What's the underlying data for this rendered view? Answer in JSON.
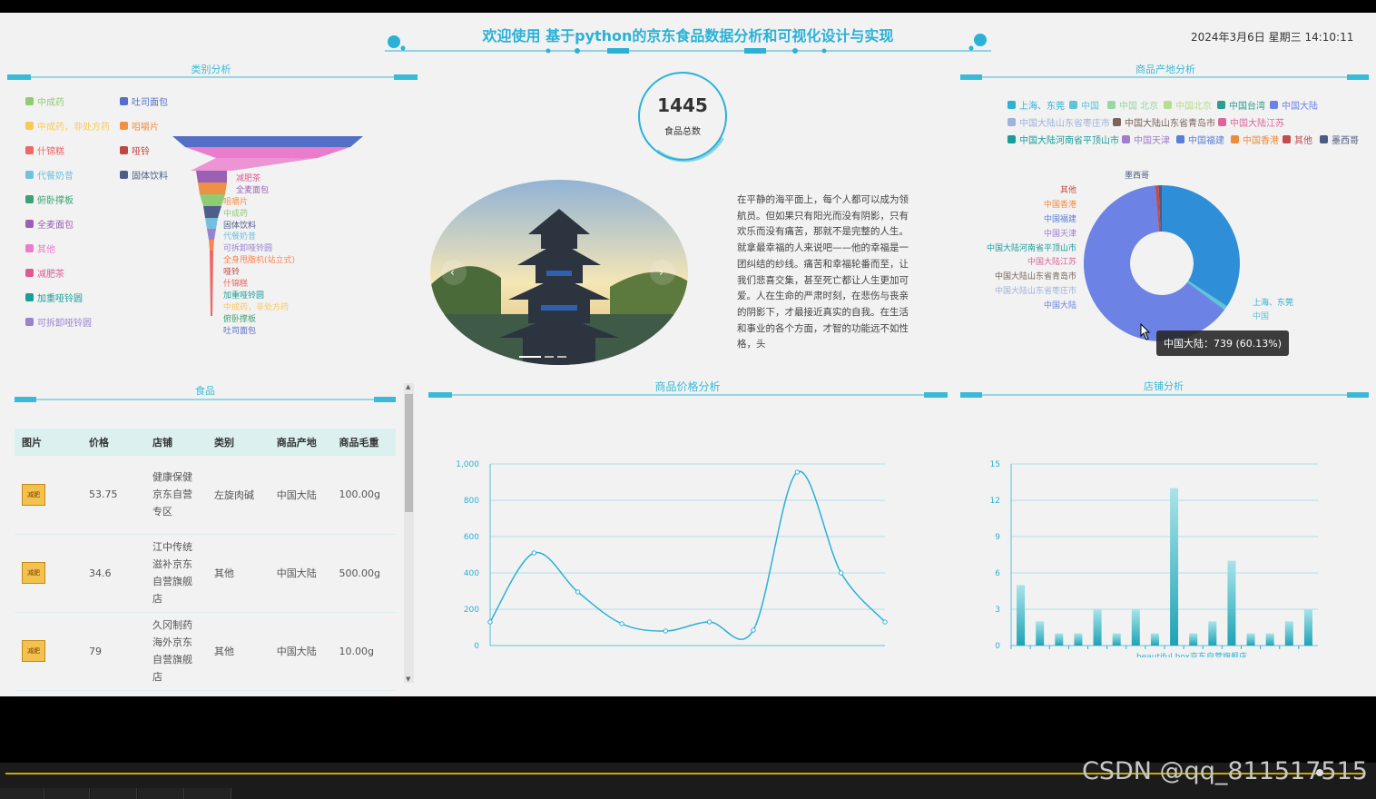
{
  "header": {
    "title": "欢迎使用 基于python的京东食品数据分析和可视化设计与实现",
    "datetime": "2024年3月6日 星期三 14:10:11"
  },
  "category_panel": {
    "title": "类别分析",
    "legend": [
      {
        "label": "中成药",
        "color": "#91cc75"
      },
      {
        "label": "吐司面包",
        "color": "#5470c6"
      },
      {
        "label": "中成药，非处方药",
        "color": "#fac858"
      },
      {
        "label": "咀嚼片",
        "color": "#ee9144"
      },
      {
        "label": "什锦糕",
        "color": "#ee6666"
      },
      {
        "label": "哑铃",
        "color": "#c04545"
      },
      {
        "label": "代餐奶昔",
        "color": "#73c0de"
      },
      {
        "label": "固体饮料",
        "color": "#4f5d8a"
      },
      {
        "label": "俯卧撑板",
        "color": "#3ba272"
      },
      {
        "label": "全身甩脂机(站立式)",
        "color": "#fc8452"
      },
      {
        "label": "全麦面包",
        "color": "#9a60b4"
      },
      {
        "label": "其他",
        "color": "#ea7ccc"
      },
      {
        "label": "减肥茶",
        "color": "#e05a92"
      },
      {
        "label": "加重哑铃圆",
        "color": "#1a9e9a"
      },
      {
        "label": "可拆卸哑铃圆",
        "color": "#9a82d0"
      }
    ],
    "funnel_labels": [
      "其他",
      "减肥茶",
      "全麦面包",
      "咀嚼片",
      "中成药",
      "固体饮料",
      "代餐奶昔",
      "可拆卸哑铃圆",
      "全身甩脂机(站立式)",
      "哑铃",
      "什锦糕",
      "加重哑铃圆",
      "中成药，非处方药",
      "俯卧撑板",
      "吐司面包"
    ]
  },
  "center": {
    "total": "1445",
    "total_label": "食品总数",
    "description": "在平静的海平面上，每个人都可以成为领航员。但如果只有阳光而没有阴影，只有欢乐而没有痛苦，那就不是完整的人生。就拿最幸福的人来说吧——他的幸福是一团纠结的纱线。痛苦和幸福轮番而至，让我们悲喜交集，甚至死亡都让人生更加可爱。人在生命的严肃时刻，在悲伤与丧亲的阴影下，才最接近真实的自我。在生活和事业的各个方面，才智的功能远不如性格，头"
  },
  "origin_panel": {
    "title": "商品产地分析",
    "legend": [
      {
        "label": "上海、东莞",
        "color": "#2db1d4"
      },
      {
        "label": "中国",
        "color": "#5cc5d7"
      },
      {
        "label": "中国 北京",
        "color": "#9bd6a7"
      },
      {
        "label": "中国北京",
        "color": "#b7de8c"
      },
      {
        "label": "中国台湾",
        "color": "#2d9d8f"
      },
      {
        "label": "中国大陆",
        "color": "#6c82e4"
      },
      {
        "label": "中国大陆山东省枣庄市",
        "color": "#9fb2da"
      },
      {
        "label": "中国大陆山东省青岛市",
        "color": "#7b6358"
      },
      {
        "label": "中国大陆江苏",
        "color": "#e0649c"
      },
      {
        "label": "中国大陆河南省平顶山市",
        "color": "#169e9b"
      },
      {
        "label": "中国天津",
        "color": "#a07ccf"
      },
      {
        "label": "中国福建",
        "color": "#5b7fd6"
      },
      {
        "label": "中国香港",
        "color": "#ec8b3c"
      },
      {
        "label": "其他",
        "color": "#c24b4b"
      },
      {
        "label": "墨西哥",
        "color": "#4d5a82"
      }
    ],
    "left_labels": [
      "墨西哥",
      "其他",
      "中国香港",
      "中国福建",
      "中国天津",
      "中国大陆河南省平顶山市",
      "中国大陆江苏",
      "中国大陆山东省青岛市",
      "中国大陆山东省枣庄市",
      "中国大陆"
    ],
    "right_labels": [
      "上海、东莞",
      "中国"
    ],
    "tooltip": "中国大陆：739 (60.13%)"
  },
  "food_panel": {
    "title": "食品",
    "headers": [
      "图片",
      "价格",
      "店铺",
      "类别",
      "商品产地",
      "商品毛重"
    ],
    "rows": [
      {
        "img": "减肥",
        "price": "53.75",
        "shop": "健康保健京东自营专区",
        "category": "左旋肉碱",
        "origin": "中国大陆",
        "weight": "100.00g"
      },
      {
        "img": "减肥",
        "price": "34.6",
        "shop": "江中传统滋补京东自营旗舰店",
        "category": "其他",
        "origin": "中国大陆",
        "weight": "500.00g"
      },
      {
        "img": "减肥",
        "price": "79",
        "shop": "久冈制药海外京东自营旗舰店",
        "category": "其他",
        "origin": "中国大陆",
        "weight": "10.00g"
      }
    ]
  },
  "price_panel": {
    "title": "商品价格分析"
  },
  "shop_panel": {
    "title": "店铺分析"
  },
  "chart_data": [
    {
      "type": "line",
      "title": "商品价格分析",
      "y": [
        130,
        510,
        295,
        120,
        80,
        130,
        85,
        955,
        400,
        130
      ],
      "ylim": [
        0,
        1000
      ],
      "yticks": [
        "0",
        "200",
        "400",
        "600",
        "800",
        "1,000"
      ]
    },
    {
      "type": "bar",
      "title": "店铺分析",
      "xlabel_visible": "beautiful box京东自营旗舰店",
      "values": [
        5,
        2,
        1,
        1,
        3,
        1,
        3,
        1,
        13,
        1,
        2,
        7,
        1,
        1,
        2,
        3
      ],
      "ylim": [
        0,
        15
      ],
      "yticks": [
        "0",
        "3",
        "6",
        "9",
        "12",
        "15"
      ]
    }
  ],
  "footer": {
    "watermark": "CSDN @qq_811517515"
  }
}
